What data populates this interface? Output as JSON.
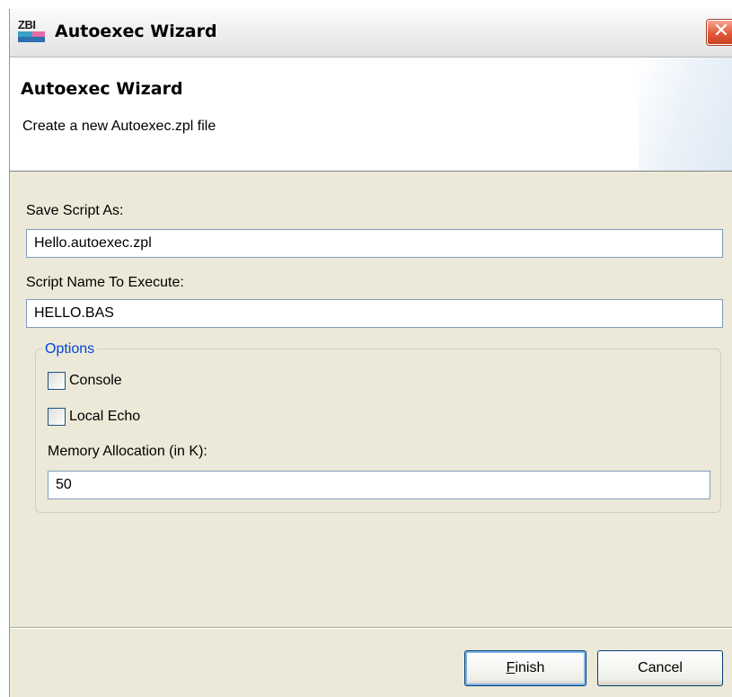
{
  "window": {
    "title": "Autoexec Wizard",
    "logo_text": "ZBI",
    "close_glyph": "✕"
  },
  "header": {
    "title": "Autoexec Wizard",
    "description": "Create a new Autoexec.zpl file"
  },
  "form": {
    "save_script_label": "Save Script As:",
    "save_script_value": "Hello.autoexec.zpl",
    "script_name_label": "Script Name To Execute:",
    "script_name_value": "HELLO.BAS",
    "options": {
      "legend": "Options",
      "console_label": "Console",
      "console_checked": false,
      "local_echo_label": "Local Echo",
      "local_echo_checked": false,
      "memory_label": "Memory Allocation (in K):",
      "memory_value": "50"
    }
  },
  "buttons": {
    "finish_mnemonic": "F",
    "finish_rest": "inish",
    "cancel_label": "Cancel"
  },
  "colors": {
    "dialog_bg": "#ece9d8",
    "group_legend": "#0046d5",
    "close_button": "#e15a3a"
  }
}
